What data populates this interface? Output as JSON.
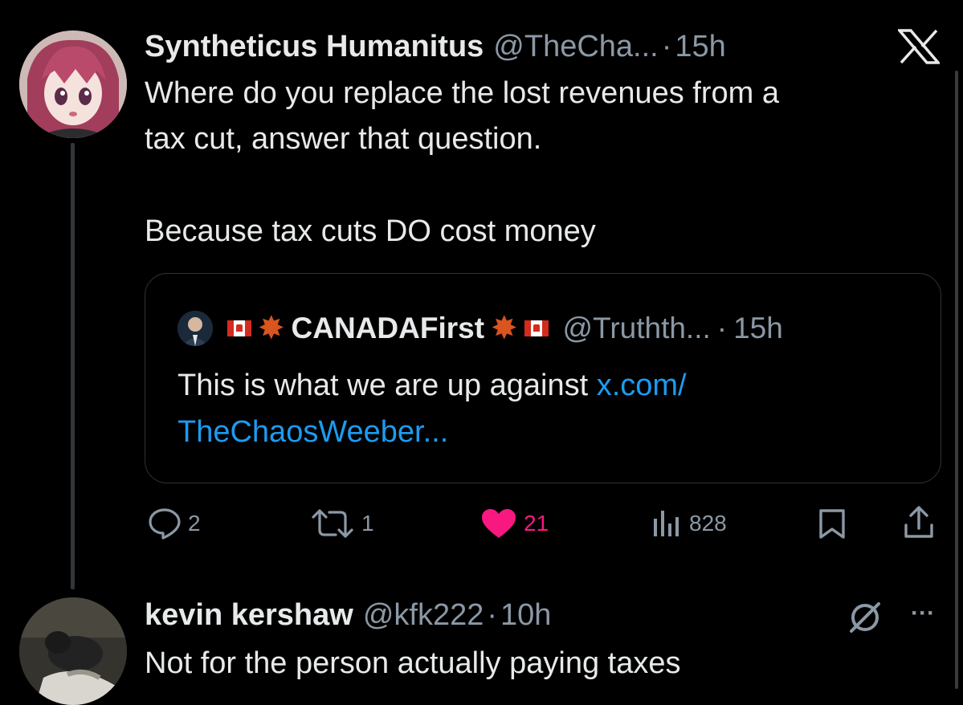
{
  "tweet1": {
    "display_name": "Syntheticus Humanitus",
    "handle": "@TheCha...",
    "separator": "·",
    "time": "15h",
    "text_line1": "Where do you replace the lost revenues from a",
    "text_line2": "tax cut, answer that question.",
    "text_line3": "Because tax cuts DO cost money",
    "quote": {
      "name_prefix_flag": "🇨🇦",
      "name": "CANADAFirst",
      "handle": "@Truthth...",
      "separator": "·",
      "time": "15h",
      "text": "This is what we are up against ",
      "link_line1": "x.com/",
      "link_line2": "TheChaosWeeber..."
    },
    "actions": {
      "replies": "2",
      "reposts": "1",
      "likes": "21",
      "views": "828"
    }
  },
  "tweet2": {
    "display_name": "kevin kershaw",
    "handle": "@kfk222",
    "separator": "·",
    "time": "10h",
    "text": "Not for the person actually paying taxes",
    "more": "···"
  },
  "colors": {
    "background": "#000000",
    "text": "#e7e9ea",
    "muted": "#8b98a5",
    "link": "#1d9bf0",
    "like": "#f91880",
    "thread_line": "#333639",
    "card_border": "#2f3336"
  }
}
